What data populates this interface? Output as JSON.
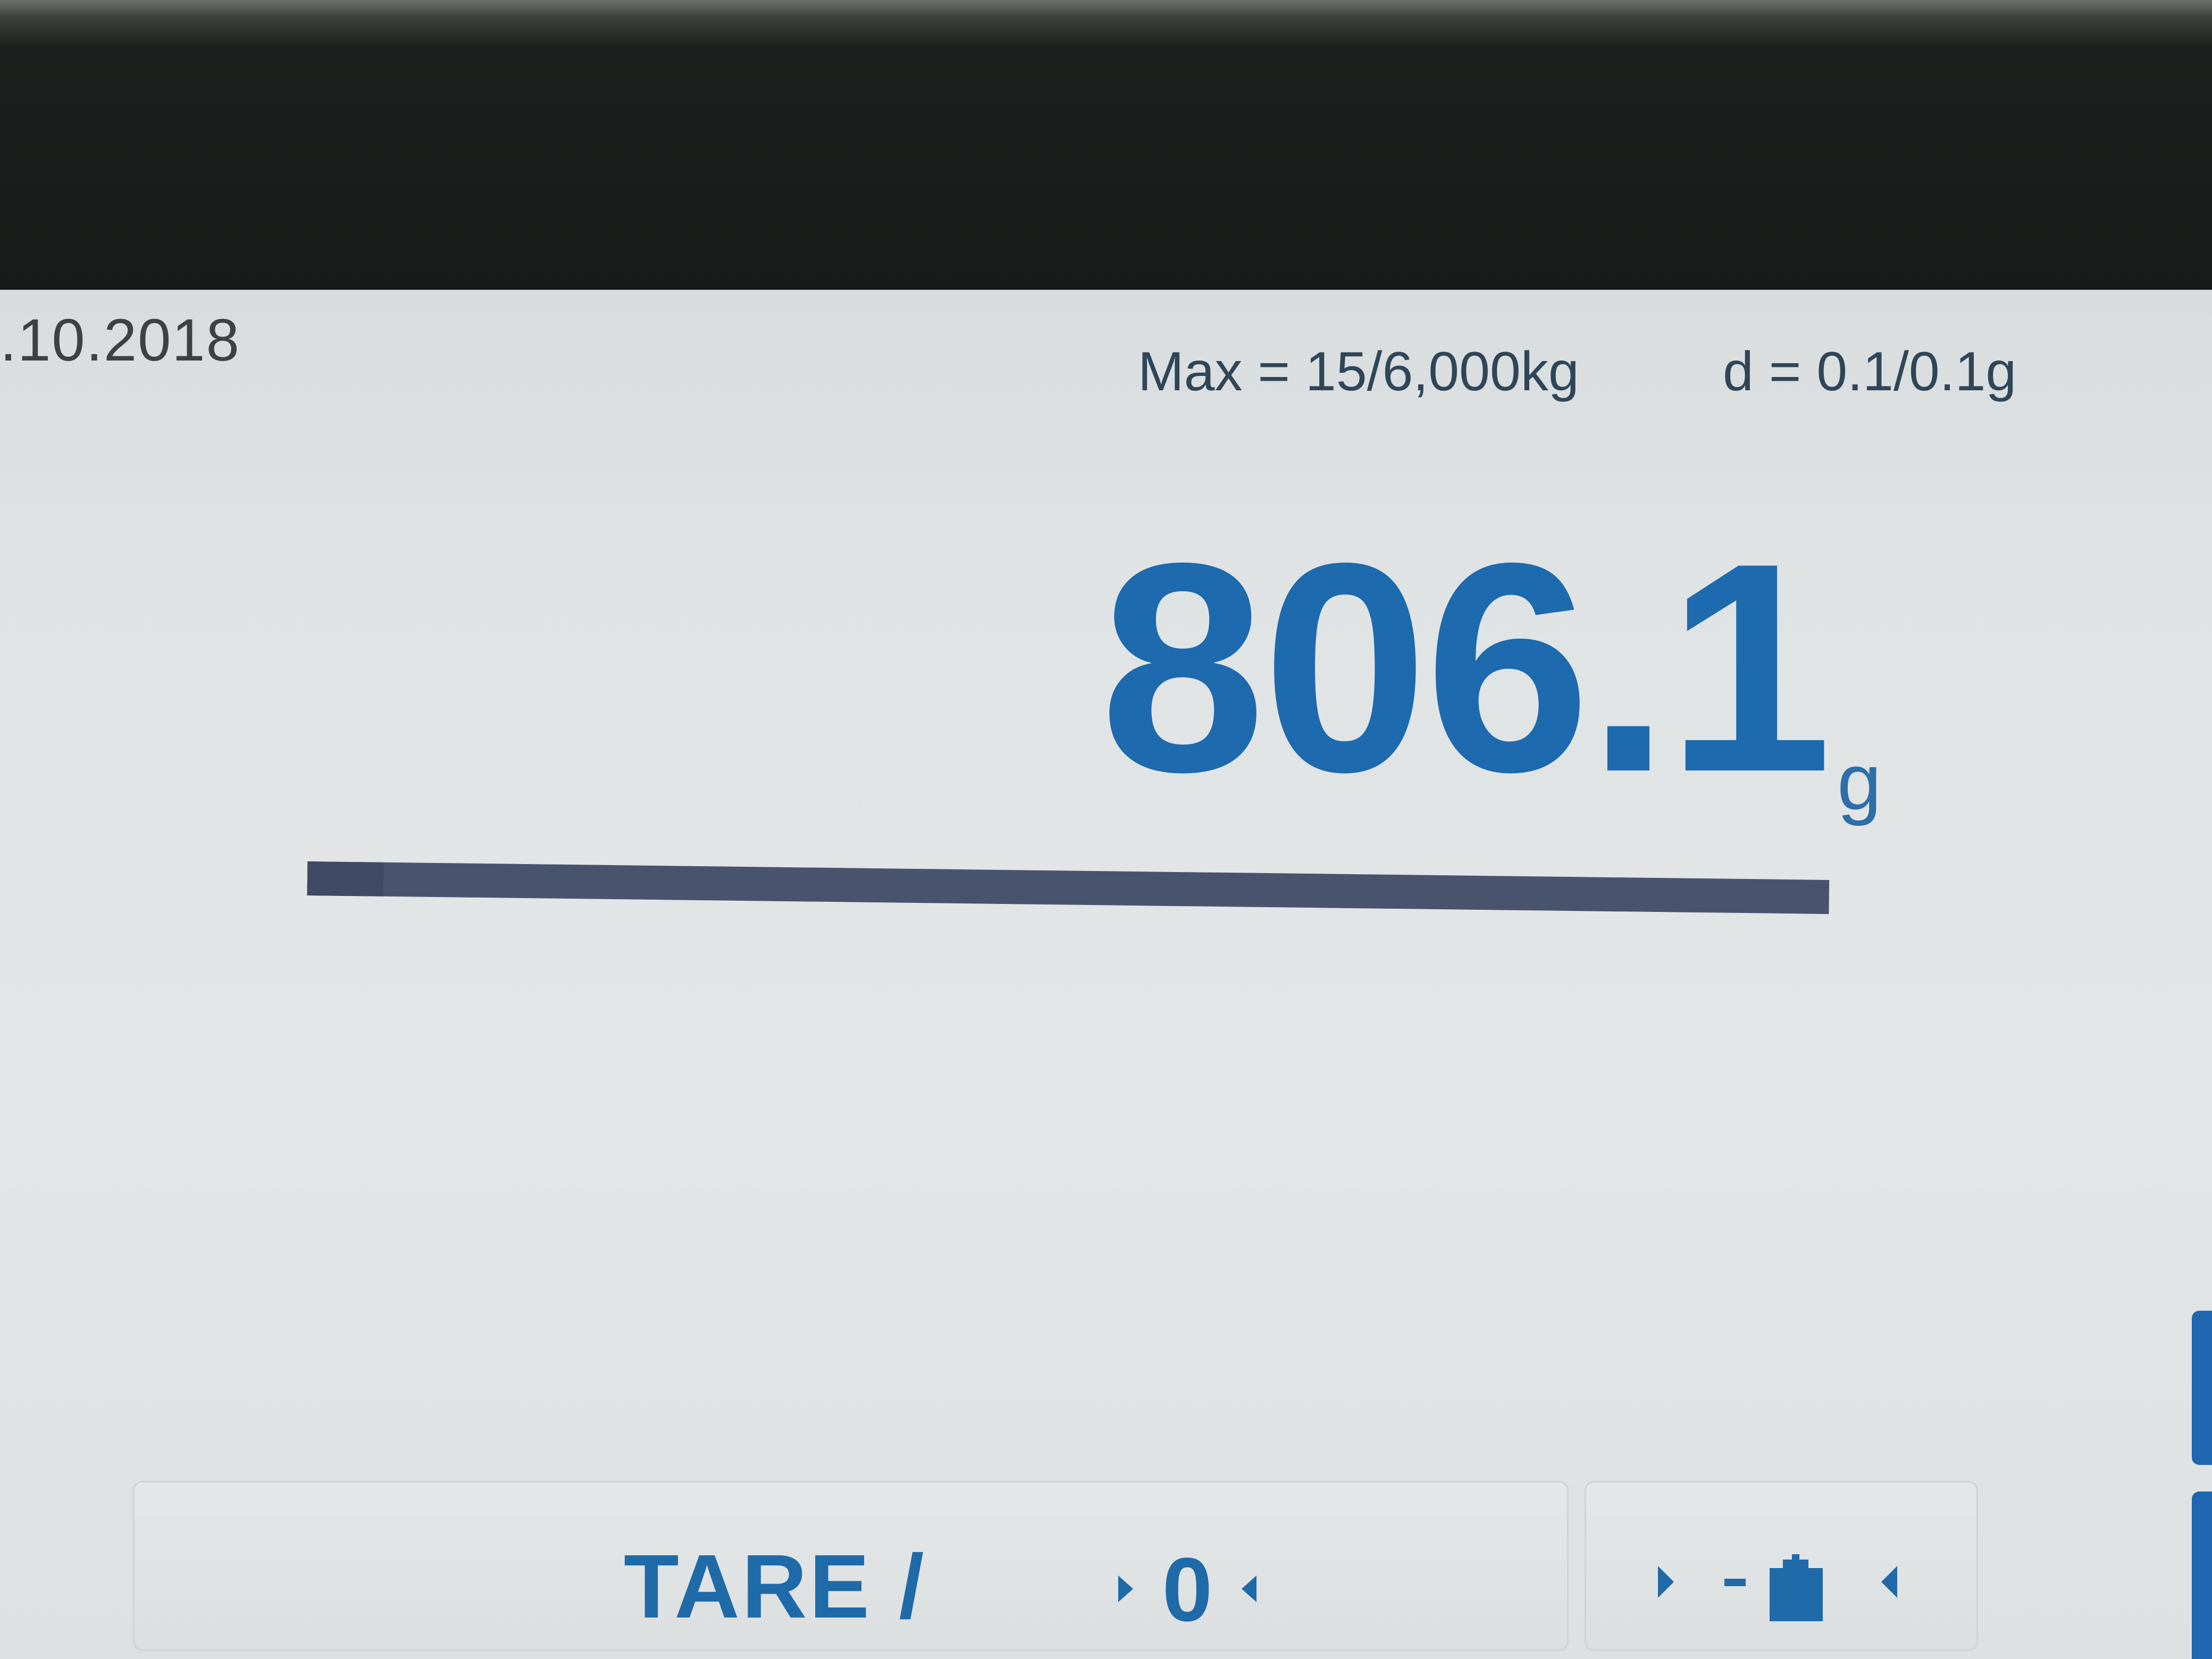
{
  "header": {
    "date": ".10.2018",
    "max_capacity": "Max = 15/6,000kg",
    "division": "d = 0.1/0.1g"
  },
  "weighing": {
    "value": "806.1",
    "unit": "g",
    "capacity_fraction": 0.05
  },
  "softkeys": {
    "tare_label": "TARE /",
    "zero_symbol": "zero-icon",
    "tare_weight_symbol": "set-tare-icon"
  },
  "colors": {
    "accent_blue": "#1d6aae",
    "bar_navy": "#48536e",
    "screen_background": "#e1e4e5"
  }
}
